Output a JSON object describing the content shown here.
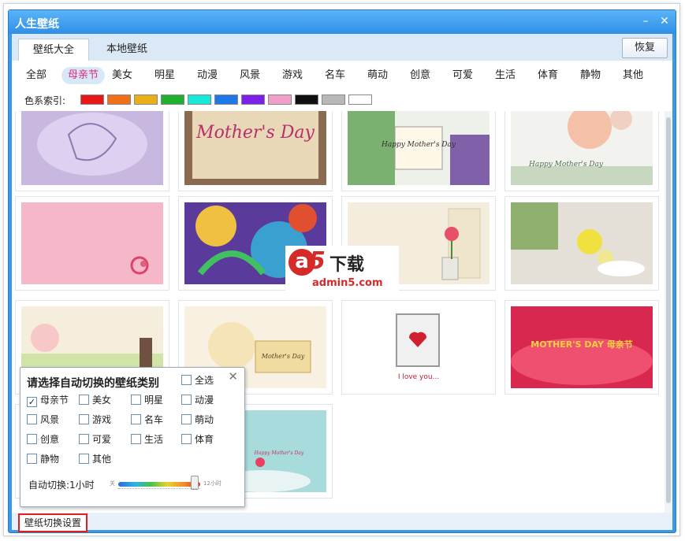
{
  "window": {
    "title": "人生壁纸"
  },
  "window_buttons": {
    "minimize": "–",
    "close": "✕"
  },
  "tabs": [
    {
      "label": "壁纸大全"
    },
    {
      "label": "本地壁纸"
    }
  ],
  "restore_label": "恢复",
  "categories": [
    "全部",
    "母亲节",
    "美女",
    "明星",
    "动漫",
    "风景",
    "游戏",
    "名车",
    "萌动",
    "创意",
    "可爱",
    "生活",
    "体育",
    "静物",
    "其他"
  ],
  "selected_category": "母亲节",
  "color_index": {
    "label": "色系索引:",
    "colors": [
      "#e81818",
      "#f0701a",
      "#e8b016",
      "#20b030",
      "#18e8d8",
      "#1e78e8",
      "#7a20e8",
      "#f0a0c8",
      "#101010",
      "#b8b8b8",
      "#ffffff"
    ]
  },
  "thumbnails": [
    {
      "caption": ""
    },
    {
      "caption": "Mother's Day"
    },
    {
      "caption": "Happy Mother's Day"
    },
    {
      "caption": "Happy Mother's Day"
    },
    {
      "caption": ""
    },
    {
      "caption": ""
    },
    {
      "caption": ""
    },
    {
      "caption": ""
    },
    {
      "caption": ""
    },
    {
      "caption": "Mother's Day"
    },
    {
      "caption": "I love you..."
    },
    {
      "caption": "MOTHER'S DAY 母亲节"
    },
    {
      "caption": "Happy Mother's Day"
    }
  ],
  "popup": {
    "title": "请选择自动切换的壁纸类别",
    "close": "✕",
    "options": [
      {
        "label": "全选",
        "checked": false
      },
      {
        "label": "母亲节",
        "checked": true
      },
      {
        "label": "美女",
        "checked": false
      },
      {
        "label": "明星",
        "checked": false
      },
      {
        "label": "动漫",
        "checked": false
      },
      {
        "label": "风景",
        "checked": false
      },
      {
        "label": "游戏",
        "checked": false
      },
      {
        "label": "名车",
        "checked": false
      },
      {
        "label": "萌动",
        "checked": false
      },
      {
        "label": "创意",
        "checked": false
      },
      {
        "label": "可爱",
        "checked": false
      },
      {
        "label": "生活",
        "checked": false
      },
      {
        "label": "体育",
        "checked": false
      },
      {
        "label": "静物",
        "checked": false
      },
      {
        "label": "其他",
        "checked": false
      }
    ],
    "auto_switch_label": "自动切换:1小时",
    "slider_min_label": "关",
    "slider_max_label": "12小时",
    "slider_level": 0.92
  },
  "settings_button": "壁纸切换设置",
  "watermark": {
    "logo_a": "a",
    "logo_5": "5",
    "logo_text": "下载",
    "url": "admin5.com"
  }
}
